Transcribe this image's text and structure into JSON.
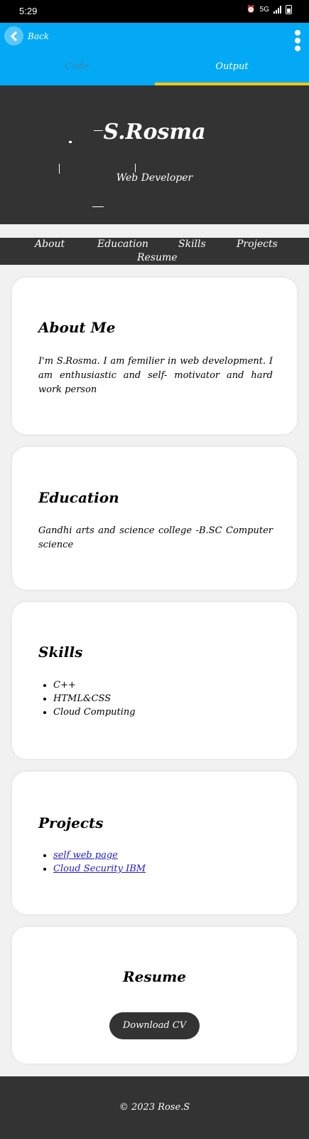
{
  "status_bar": {
    "time": "5:29",
    "network": "5G"
  },
  "app_bar": {
    "back_label": "Back",
    "tabs": [
      "Code",
      "Output"
    ],
    "selected_tab": "Output",
    "accent": "#03a9f4",
    "indicator_color": "#f5c51a"
  },
  "hero": {
    "name": "S.Rosma",
    "title": "Web Developer"
  },
  "nav": [
    "About",
    "Education",
    "Skills",
    "Projects",
    "Resume"
  ],
  "about": {
    "heading": "About Me",
    "text": "I'm S.Rosma. I am femilier in web development. I am enthusiastic and self- motivator and hard work person"
  },
  "education": {
    "heading": "Education",
    "text": "Gandhi arts and science college -B.SC Computer science"
  },
  "skills": {
    "heading": "Skills",
    "items": [
      "C++",
      "HTML&CSS",
      "Cloud Computing"
    ]
  },
  "projects": {
    "heading": "Projects",
    "items": [
      "self web page",
      "Cloud Security IBM"
    ]
  },
  "resume": {
    "heading": "Resume",
    "button": "Download CV"
  },
  "footer": "© 2023 Rose.S",
  "colors": {
    "dark": "#333333",
    "link": "#1f1ac7"
  }
}
